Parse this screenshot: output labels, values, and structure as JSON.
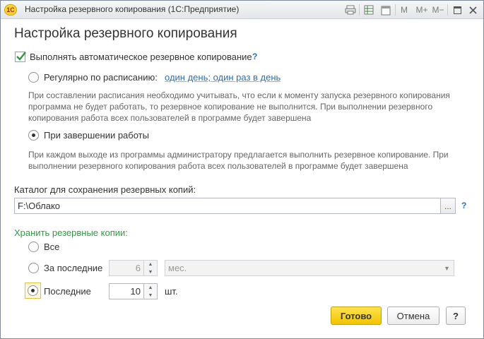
{
  "window": {
    "title": "Настройка резервного копирования  (1С:Предприятие)",
    "logo_text": "1С",
    "toolbar": {
      "print_icon": "printer-icon",
      "spreadsheet_icon": "spreadsheet-icon",
      "calendar_icon": "calendar-icon",
      "calendar_label": "31",
      "m_label": "M",
      "m_plus_label": "M+",
      "m_minus_label": "M−",
      "maximize_icon": "maximize-icon",
      "close_icon": "close-icon"
    }
  },
  "heading": "Настройка резервного копирования",
  "auto_backup": {
    "label": "Выполнять автоматическое резервное копирование",
    "checked": true,
    "help": "?"
  },
  "schedule_option": {
    "label": "Регулярно по расписанию:",
    "link": "один день; один раз в день",
    "selected": false,
    "note": "При составлении расписания необходимо учитывать, что если к моменту запуска резервного копирования программа не будет работать, то резервное копирование не выполнится. При выполнении резервного копирования работа всех пользователей в программе будет завершена"
  },
  "on_exit_option": {
    "label": "При завершении работы",
    "selected": true,
    "note": "При каждом выходе из программы администратору предлагается выполнить резервное копирование. При выполнении резервного копирования работа всех пользователей в программе будет завершена"
  },
  "directory": {
    "label": "Каталог для сохранения резервных копий:",
    "value": "F:\\Облако",
    "browse_label": "...",
    "help": "?"
  },
  "retention": {
    "label": "Хранить резервные копии:",
    "all_label": "Все",
    "last_period_label": "За последние",
    "last_period_value": "6",
    "last_period_unit": "мес.",
    "last_count_label": "Последние",
    "last_count_value": "10",
    "last_count_unit": "шт.",
    "selected": "last_count"
  },
  "buttons": {
    "ok": "Готово",
    "cancel": "Отмена",
    "help": "?"
  },
  "colors": {
    "accent_link": "#2a6fb8",
    "section_green": "#2e9a3e",
    "primary_button": "#f2c400",
    "check_green": "#2e9a3e"
  }
}
